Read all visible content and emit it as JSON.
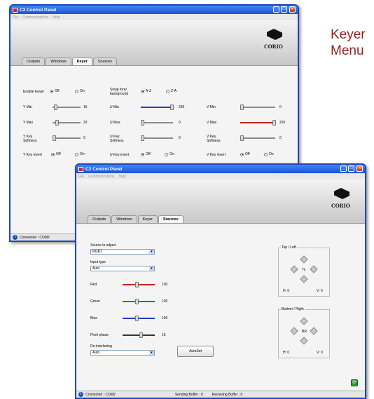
{
  "caption": {
    "line1": "Keyer",
    "line2": "Menu"
  },
  "back_window": {
    "title": "C2 Control Panel",
    "menu": [
      "File",
      "Communications",
      "Help"
    ],
    "logo_text": "CORIO",
    "tabs": [
      "Outputs",
      "Windows",
      "Keyer",
      "Sources"
    ],
    "active_tab": "Keyer",
    "enable_keyer": {
      "label": "Enable Keyer",
      "off": "Off",
      "on": "On"
    },
    "swap": {
      "label1": "Swap fore/",
      "label2": "background",
      "az": "A-Z",
      "za": "Z-A"
    },
    "rows": [
      {
        "label": "Y Min",
        "value": "16"
      },
      {
        "label": "Y Max",
        "value": "32"
      },
      {
        "label": "Y Key Softness",
        "value": "0"
      },
      {
        "label": "U Min",
        "value": "255"
      },
      {
        "label": "U Max",
        "value": "0"
      },
      {
        "label": "U Key Softness",
        "value": "0"
      },
      {
        "label": "V Min",
        "value": "0"
      },
      {
        "label": "V Max",
        "value": "255"
      },
      {
        "label": "V Key Softness",
        "value": "0"
      }
    ],
    "inverts": [
      {
        "label": "Y Key invert",
        "off": "Off",
        "on": "On"
      },
      {
        "label": "U Key invert",
        "off": "Off",
        "on": "On"
      },
      {
        "label": "V Key invert",
        "off": "Off",
        "on": "On"
      }
    ],
    "status": "Connected : COM2"
  },
  "front_window": {
    "title": "C2 Control Panel",
    "menu": [
      "File",
      "Communications",
      "Help"
    ],
    "logo_text": "CORIO",
    "tabs": [
      "Outputs",
      "Windows",
      "Keyer",
      "Sources"
    ],
    "active_tab": "Sources",
    "source_label": "Source to adjust",
    "source_value": "RGB1",
    "input_type_label": "Input type",
    "input_type_value": "Auto",
    "sliders": [
      {
        "label": "Red",
        "value": "100",
        "color": "#cc1f1f"
      },
      {
        "label": "Green",
        "value": "100",
        "color": "#1d8a2a"
      },
      {
        "label": "Blue",
        "value": "100",
        "color": "#1f3fc0"
      },
      {
        "label": "Pixel phase",
        "value": "16",
        "color": "#333333"
      }
    ],
    "deinterlacing_label": "De-interlacing",
    "deinterlacing_value": "Auto",
    "autoset": "AutoSet",
    "top_left": {
      "title": "Top / Left",
      "center": "TL",
      "h": "H: 0",
      "v": "V: 0"
    },
    "bottom_right": {
      "title": "Bottom / Right",
      "center": "BR",
      "h": "H: 0",
      "v": "V: 0"
    },
    "status": {
      "connected": "Connected : COM2",
      "sending": "Sending Buffer : 0",
      "receiving": "Receiving Buffer : 0"
    }
  }
}
